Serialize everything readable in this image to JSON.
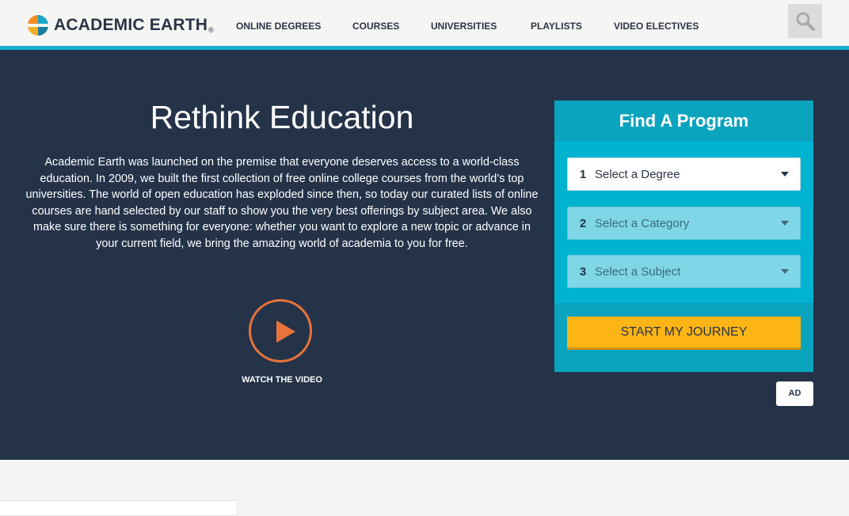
{
  "header": {
    "logo_text": "ACADEMIC EARTH",
    "logo_reg": "®",
    "nav": [
      {
        "label": "ONLINE DEGREES"
      },
      {
        "label": "COURSES"
      },
      {
        "label": "UNIVERSITIES"
      },
      {
        "label": "PLAYLISTS"
      },
      {
        "label": "VIDEO ELECTIVES"
      }
    ],
    "search_icon": "search-icon"
  },
  "hero": {
    "title": "Rethink Education",
    "description": "Academic Earth was launched on the premise that everyone deserves access to a world-class education. In 2009, we built the first collection of free online college courses from the world’s top universities. The world of open education has exploded since then, so today our curated lists of online courses are hand selected by our staff to show you the very best offerings by subject area. We also make sure there is something for everyone: whether you want to explore a new topic or advance in your current field, we bring the amazing world of academia to you for free.",
    "watch_label": "WATCH THE VIDEO"
  },
  "finder": {
    "title": "Find A Program",
    "selects": [
      {
        "num": "1",
        "label": "Select a Degree",
        "state": "active"
      },
      {
        "num": "2",
        "label": "Select a Category",
        "state": "disabled"
      },
      {
        "num": "3",
        "label": "Select a Subject",
        "state": "disabled"
      }
    ],
    "button_label": "START MY JOURNEY",
    "ad_label": "AD"
  },
  "colors": {
    "navy": "#253349",
    "teal": "#00b4d0",
    "stripe": "#16aecf",
    "yellow": "#fdb515",
    "orange": "#e8743a"
  }
}
